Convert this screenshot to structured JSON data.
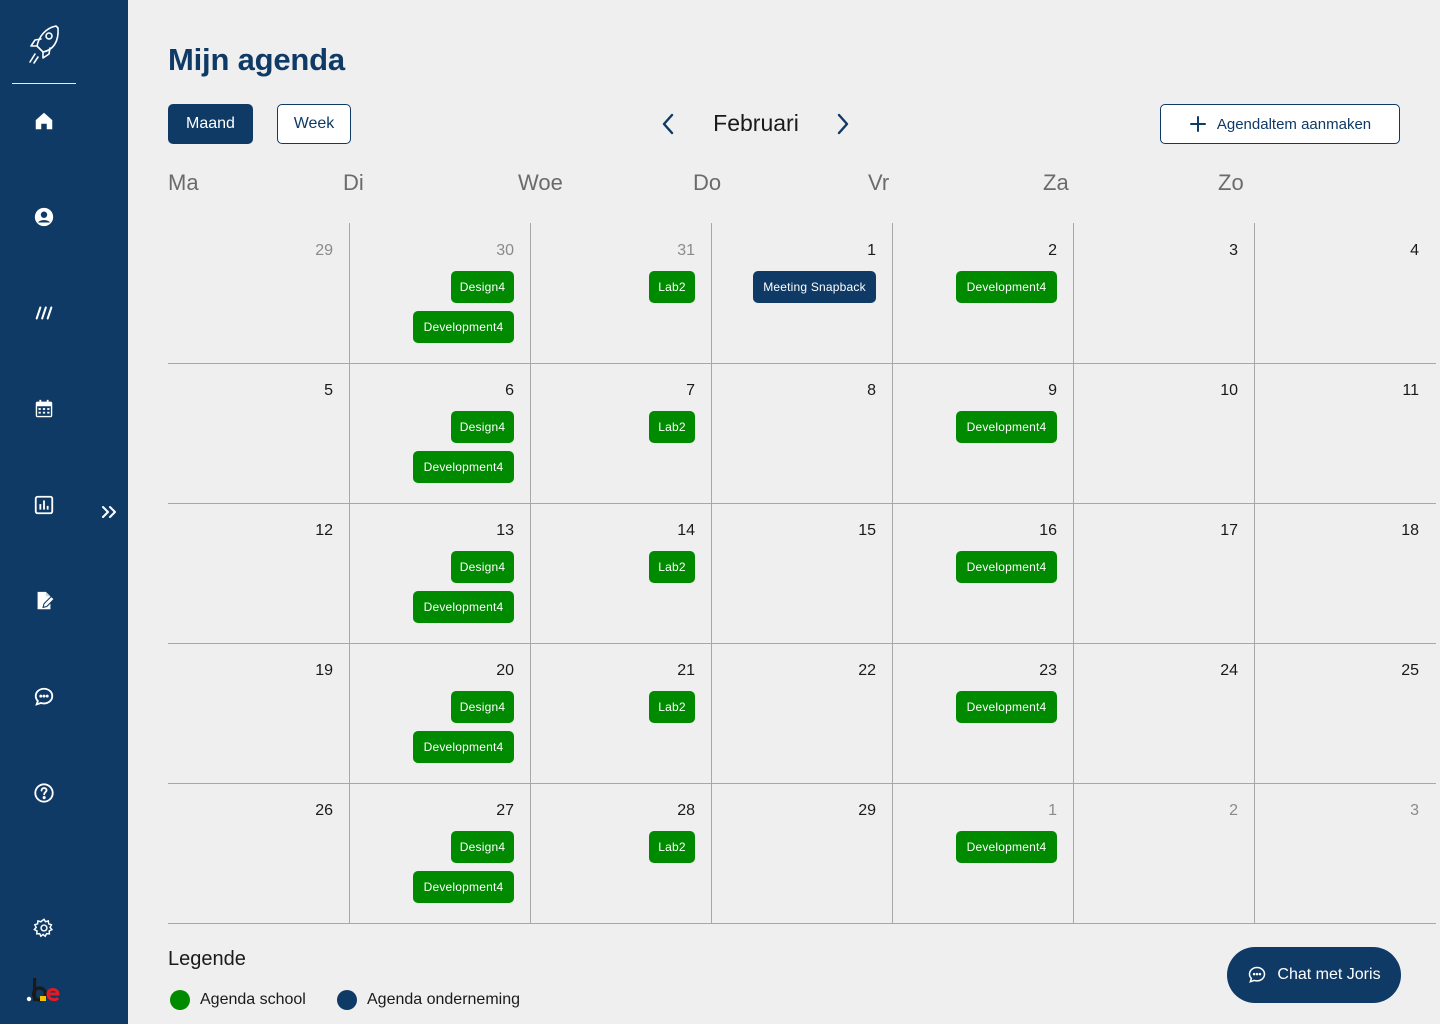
{
  "sidebar": {
    "icons": [
      "rocket-logo-icon",
      "home-icon",
      "profile-icon",
      "slashes-icon",
      "calendar-icon",
      "chart-icon",
      "document-edit-icon",
      "chat-icon",
      "help-icon",
      "settings-icon"
    ],
    "expand_icon": "double-chevron-right-icon",
    "brand_text": ".be"
  },
  "header": {
    "title": "Mijn agenda",
    "view_month_label": "Maand",
    "view_week_label": "Week",
    "month": "Februari",
    "create_label": "Agendaltem aanmaken"
  },
  "weekdays": [
    "Ma",
    "Di",
    "Woe",
    "Do",
    "Vr",
    "Za",
    "Zo"
  ],
  "weeks": [
    [
      {
        "day": "29",
        "muted": true,
        "events": []
      },
      {
        "day": "30",
        "muted": true,
        "events": [
          {
            "label": "Design4",
            "type": "school"
          },
          {
            "label": "Development4",
            "type": "school"
          }
        ]
      },
      {
        "day": "31",
        "muted": true,
        "events": [
          {
            "label": "Lab2",
            "type": "school"
          }
        ]
      },
      {
        "day": "1",
        "muted": false,
        "events": [
          {
            "label": "Meeting Snapback",
            "type": "company"
          }
        ]
      },
      {
        "day": "2",
        "muted": false,
        "events": [
          {
            "label": "Development4",
            "type": "school"
          }
        ]
      },
      {
        "day": "3",
        "muted": false,
        "events": []
      },
      {
        "day": "4",
        "muted": false,
        "events": []
      }
    ],
    [
      {
        "day": "5",
        "muted": false,
        "events": []
      },
      {
        "day": "6",
        "muted": false,
        "events": [
          {
            "label": "Design4",
            "type": "school"
          },
          {
            "label": "Development4",
            "type": "school"
          }
        ]
      },
      {
        "day": "7",
        "muted": false,
        "events": [
          {
            "label": "Lab2",
            "type": "school"
          }
        ]
      },
      {
        "day": "8",
        "muted": false,
        "events": []
      },
      {
        "day": "9",
        "muted": false,
        "events": [
          {
            "label": "Development4",
            "type": "school"
          }
        ]
      },
      {
        "day": "10",
        "muted": false,
        "events": []
      },
      {
        "day": "11",
        "muted": false,
        "events": []
      }
    ],
    [
      {
        "day": "12",
        "muted": false,
        "events": []
      },
      {
        "day": "13",
        "muted": false,
        "events": [
          {
            "label": "Design4",
            "type": "school"
          },
          {
            "label": "Development4",
            "type": "school"
          }
        ]
      },
      {
        "day": "14",
        "muted": false,
        "events": [
          {
            "label": "Lab2",
            "type": "school"
          }
        ]
      },
      {
        "day": "15",
        "muted": false,
        "events": []
      },
      {
        "day": "16",
        "muted": false,
        "events": [
          {
            "label": "Development4",
            "type": "school"
          }
        ]
      },
      {
        "day": "17",
        "muted": false,
        "events": []
      },
      {
        "day": "18",
        "muted": false,
        "events": []
      }
    ],
    [
      {
        "day": "19",
        "muted": false,
        "events": []
      },
      {
        "day": "20",
        "muted": false,
        "events": [
          {
            "label": "Design4",
            "type": "school"
          },
          {
            "label": "Development4",
            "type": "school"
          }
        ]
      },
      {
        "day": "21",
        "muted": false,
        "events": [
          {
            "label": "Lab2",
            "type": "school"
          }
        ]
      },
      {
        "day": "22",
        "muted": false,
        "events": []
      },
      {
        "day": "23",
        "muted": false,
        "events": [
          {
            "label": "Development4",
            "type": "school"
          }
        ]
      },
      {
        "day": "24",
        "muted": false,
        "events": []
      },
      {
        "day": "25",
        "muted": false,
        "events": []
      }
    ],
    [
      {
        "day": "26",
        "muted": false,
        "events": []
      },
      {
        "day": "27",
        "muted": false,
        "events": [
          {
            "label": "Design4",
            "type": "school"
          },
          {
            "label": "Development4",
            "type": "school"
          }
        ]
      },
      {
        "day": "28",
        "muted": false,
        "events": [
          {
            "label": "Lab2",
            "type": "school"
          }
        ]
      },
      {
        "day": "29",
        "muted": false,
        "events": []
      },
      {
        "day": "1",
        "muted": true,
        "events": [
          {
            "label": "Development4",
            "type": "school"
          }
        ]
      },
      {
        "day": "2",
        "muted": true,
        "events": []
      },
      {
        "day": "3",
        "muted": true,
        "events": []
      }
    ]
  ],
  "legend": {
    "title": "Legende",
    "items": [
      {
        "label": "Agenda school",
        "color": "#008a00"
      },
      {
        "label": "Agenda onderneming",
        "color": "#0f3a66"
      }
    ]
  },
  "chat": {
    "label": "Chat met Joris"
  },
  "colors": {
    "primary": "#0f3a66",
    "school": "#008a00",
    "background": "#efefef"
  }
}
